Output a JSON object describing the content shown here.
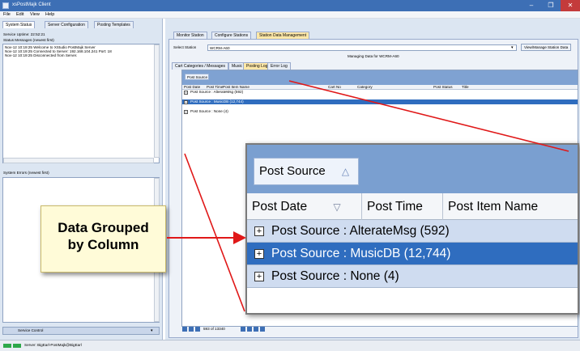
{
  "app": {
    "title": "xsPostMajk Client"
  },
  "menu": [
    "File",
    "Edit",
    "View",
    "Help"
  ],
  "left": {
    "tabs": [
      "System Status",
      "Server Configuration",
      "Posting Templates"
    ],
    "uptime": "Service Uptime:  22:52:21",
    "status_label": "Status Messages (newest first)",
    "messages": [
      "Nov-12 10:19:25  Welcome to XStudio PostMajk Server",
      "Nov-12 10:19:25  Connected to Server: 192.168.104.241 Port: 18",
      "Nov-12 10:19:25  Disconnected from Server."
    ],
    "errors_label": "System Errors (newest first)",
    "service_control": "Service Control"
  },
  "right": {
    "tabs": [
      "Monitor Station",
      "Configure Stations",
      "Station Data Management"
    ],
    "select_label": "Select Station",
    "station_value": "WCRM-A60",
    "view_button": "View/Manage Station Data",
    "managing": "Managing Data for WCRM-A60",
    "subtabs": [
      "Cart Categories / Messages",
      "Music",
      "Posting Log",
      "Error Log"
    ],
    "group_chip": "Post Source",
    "columns": [
      "Post Date",
      "Post Time",
      "Post Item Name",
      "Cart No",
      "Category",
      "Post Status",
      "Title"
    ],
    "groups": [
      "Post Source : AlterateMsg (592)",
      "Post Source : MusicDB (12,744)",
      "Post Source : None (4)"
    ],
    "pager": "593 of 13340"
  },
  "zoom": {
    "group_chip": "Post Source",
    "columns": [
      "Post Date",
      "Post Time",
      "Post Item Name"
    ],
    "rows": [
      "Post Source : AlterateMsg (592)",
      "Post Source : MusicDB (12,744)",
      "Post Source : None (4)"
    ]
  },
  "annotation": {
    "line1": "Data Grouped",
    "line2": "by Column"
  },
  "status": {
    "server": "Server: BigEarl-PostMajk@BigEarl"
  }
}
